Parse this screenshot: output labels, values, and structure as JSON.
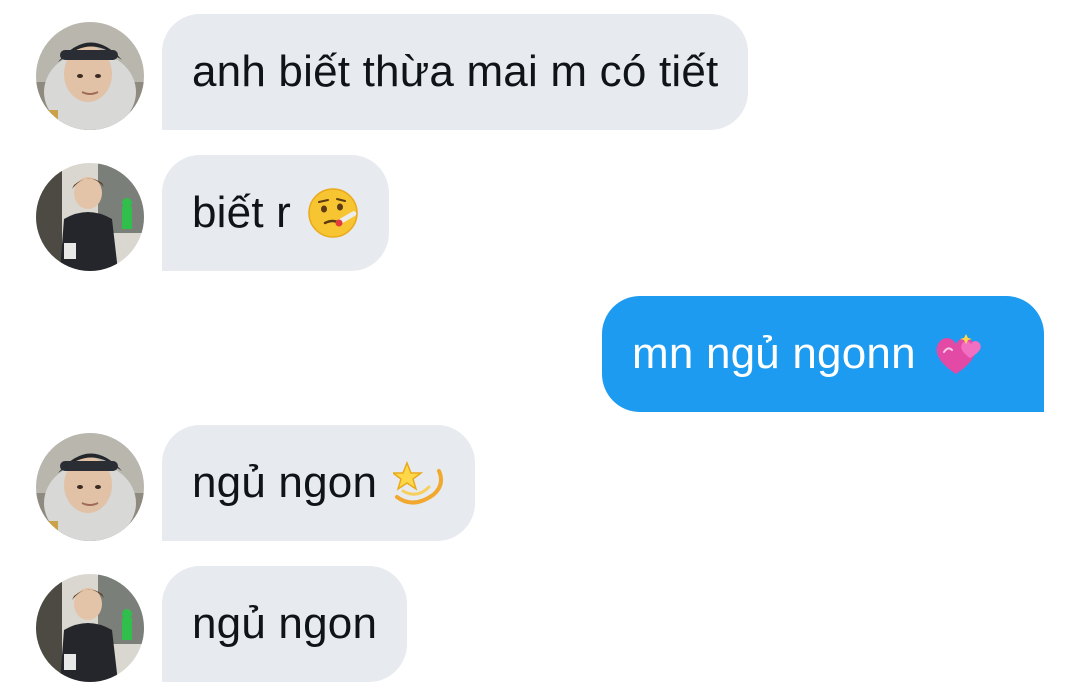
{
  "messages": [
    {
      "direction": "incoming",
      "avatar_icon": "hooded-person-avatar-icon",
      "text": "anh biết thừa mai m có tiết",
      "emoji": null
    },
    {
      "direction": "incoming",
      "avatar_icon": "standing-person-avatar-icon",
      "text": "biết r",
      "emoji": "face-with-thermometer-icon"
    },
    {
      "direction": "outgoing",
      "avatar_icon": null,
      "text": "mn ngủ ngonn",
      "emoji": "two-hearts-icon"
    },
    {
      "direction": "incoming",
      "avatar_icon": "hooded-person-avatar-icon",
      "text": "ngủ ngon",
      "emoji": "dizzy-star-icon"
    },
    {
      "direction": "incoming",
      "avatar_icon": "standing-person-avatar-icon",
      "text": "ngủ ngon",
      "emoji": null
    }
  ],
  "colors": {
    "incoming_bubble": "#e7eaee",
    "outgoing_bubble": "#1d9bf0",
    "incoming_text": "#0f1419",
    "outgoing_text": "#ffffff"
  }
}
